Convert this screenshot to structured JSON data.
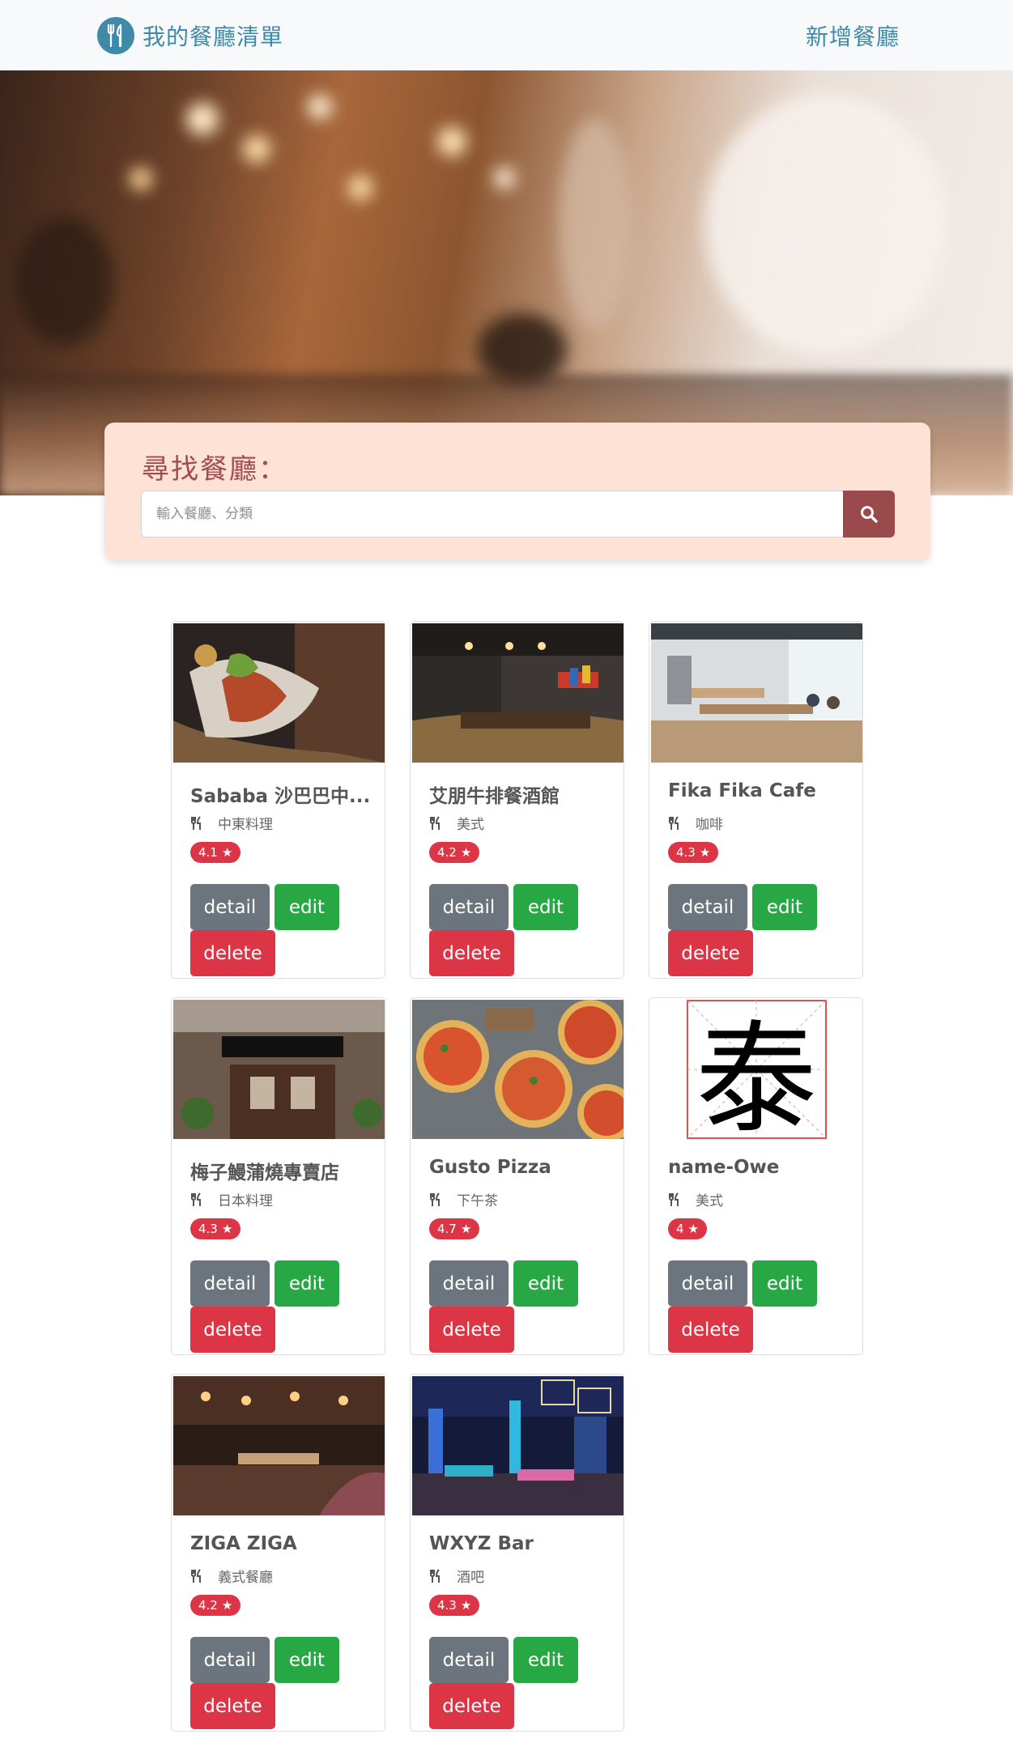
{
  "navbar": {
    "brand_title": "我的餐廳清單",
    "add_link": "新增餐廳"
  },
  "search": {
    "title": "尋找餐廳：",
    "placeholder": "輸入餐廳、分類"
  },
  "buttons": {
    "detail": "detail",
    "edit": "edit",
    "delete": "delete"
  },
  "restaurants": [
    {
      "name": "Sababa 沙巴巴中...",
      "category": "中東料理",
      "rating": "4.1",
      "image": "wrap"
    },
    {
      "name": "艾朋牛排餐酒館",
      "category": "美式",
      "rating": "4.2",
      "image": "dining-room"
    },
    {
      "name": "Fika Fika Cafe",
      "category": "咖啡",
      "rating": "4.3",
      "image": "cafe"
    },
    {
      "name": "梅子鰻蒲燒專賣店",
      "category": "日本料理",
      "rating": "4.3",
      "image": "storefront"
    },
    {
      "name": "Gusto Pizza",
      "category": "下午茶",
      "rating": "4.7",
      "image": "pizza"
    },
    {
      "name": "name-Owe",
      "category": "美式",
      "rating": "4",
      "image": "tai-character"
    },
    {
      "name": "ZIGA ZIGA",
      "category": "義式餐廳",
      "rating": "4.2",
      "image": "lounge"
    },
    {
      "name": "WXYZ Bar",
      "category": "酒吧",
      "rating": "4.3",
      "image": "bar"
    }
  ],
  "image_text": {
    "tai_character": "泰"
  },
  "colors": {
    "brand": "#3e8aa8",
    "search_panel": "#fde2d5",
    "search_title": "#a24d4d",
    "search_button": "#9b4a4b",
    "detail": "#6c757d",
    "edit": "#28a745",
    "delete": "#dc3545",
    "rating_badge": "#dc3545"
  }
}
